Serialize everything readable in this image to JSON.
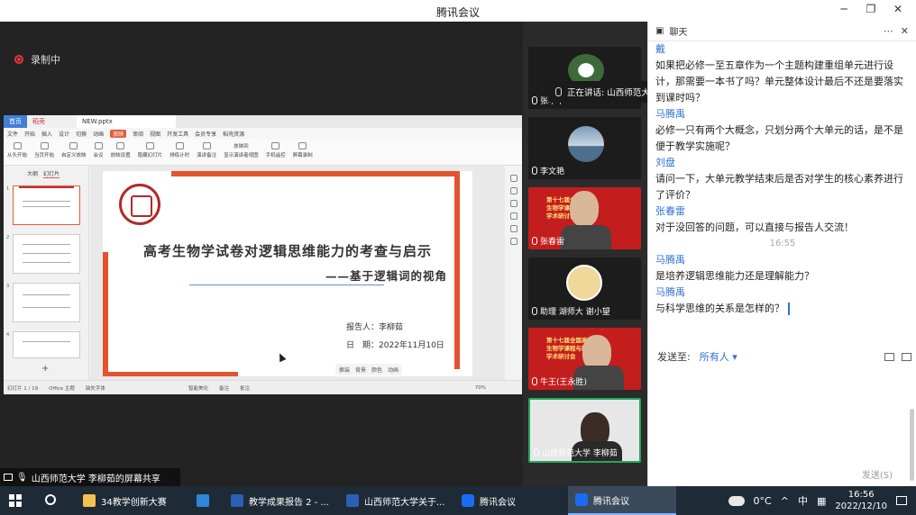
{
  "window": {
    "title": "腾讯会议"
  },
  "recording": {
    "label": "录制中"
  },
  "wps": {
    "tabs": [
      "首页",
      "稻壳",
      "NEW.pptx"
    ],
    "menu": [
      "文件",
      "开始",
      "插入",
      "设计",
      "切换",
      "动画",
      "放映",
      "审阅",
      "视图",
      "开发工具",
      "会员专享",
      "稻壳资源"
    ],
    "menu_active": "放映",
    "ribbon": [
      "从头开始",
      "当页开始",
      "自定义放映",
      "会议",
      "放映设置",
      "隐藏幻灯片",
      "排练计时",
      "演讲备注",
      "放映到",
      "显示演讲者视图",
      "手机遥控",
      "屏幕录制"
    ],
    "panel_tabs": [
      "大纲",
      "幻灯片"
    ],
    "status_left": [
      "幻灯片 1 / 19",
      "Office 主题",
      "缺失字体"
    ],
    "status_mid": [
      "智能美化",
      "备注",
      "批注"
    ],
    "zoom": "70%"
  },
  "slide": {
    "title": "高考生物学试卷对逻辑思维能力的考查与启示",
    "subtitle": "——基于逻辑词的视角",
    "reporter": "报告人：李柳茹",
    "date": "日　期：2022年11月10日",
    "mini_toolbar": [
      "换装",
      "背景",
      "颜色",
      "动画"
    ]
  },
  "speaking": {
    "text": "正在讲话: 山西师范大学 李柳茹"
  },
  "participants": [
    {
      "name": "张本华"
    },
    {
      "name": "李文艳"
    },
    {
      "name": "张春雷",
      "banner": "第十七届全国高校\n生物学课程与教学论\n学术研讨会"
    },
    {
      "name": "助理 湖师大 谢小望"
    },
    {
      "name": "牛王(王永胜)",
      "banner": "第十七届全国高校\n生物学课程与教学论\n学术研讨会"
    },
    {
      "name": "山西师范大学 李柳茹"
    }
  ],
  "chat": {
    "title": "聊天",
    "messages": [
      {
        "sender": "戴",
        "text": "如果把必修一至五章作为一个主题构建重组单元进行设计，那需要一本书了吗？单元整体设计最后不还是要落实到课时吗？"
      },
      {
        "sender": "马腾禹",
        "text": "必修一只有两个大概念，只划分两个大单元的话，是不是便于教学实施呢？"
      },
      {
        "sender": "刘盘",
        "text": "请问一下，大单元教学结束后是否对学生的核心素养进行了评价？"
      },
      {
        "sender": "张春雷",
        "text": "对于没回答的问题，可以直接与报告人交流！"
      },
      {
        "time": "16:55"
      },
      {
        "sender": "马腾禹",
        "text": "是培养逻辑思维能力还是理解能力？"
      },
      {
        "sender": "马腾禹",
        "text": "与科学思维的关系是怎样的？"
      }
    ],
    "send_to_label": "发送至:",
    "send_to_value": "所有人 ▾",
    "send_button": "发送(S)"
  },
  "share_label": "山西师范大学 李柳茹的屏幕共享",
  "taskbar": {
    "items": [
      "34教学创新大赛",
      "教学成果报告 2 - ...",
      "山西师范大学关于...",
      "腾讯会议",
      "腾讯会议"
    ],
    "weather": "0°C",
    "ime": "中",
    "time": "16:56",
    "date": "2022/12/10"
  },
  "colors": {
    "accent": "#2f6fd6",
    "record": "#e23a3a",
    "slide_red": "#e2542f",
    "banner_red": "#c41d1d"
  }
}
